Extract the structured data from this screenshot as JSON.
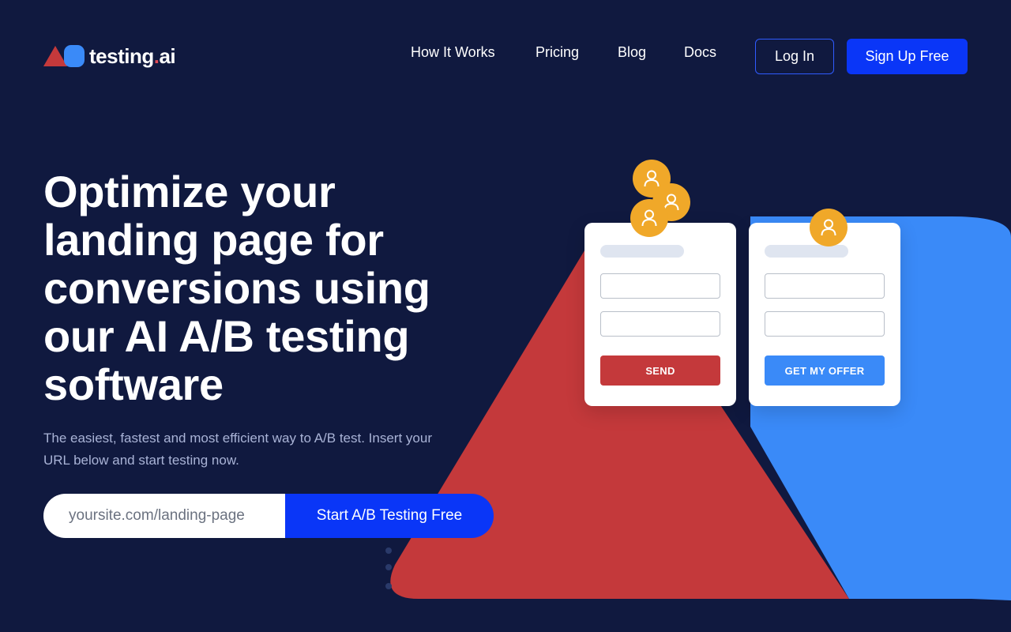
{
  "brand": {
    "name": "testing",
    "tld": "ai",
    "dot": ".",
    "colors": {
      "red": "#c4393b",
      "blue": "#3a8af8"
    }
  },
  "nav": {
    "items": [
      "How It Works",
      "Pricing",
      "Blog",
      "Docs"
    ]
  },
  "header": {
    "login_label": "Log In",
    "signup_label": "Sign Up Free"
  },
  "hero": {
    "title": "Optimize your landing page for conversions using our AI A/B testing software",
    "subtitle": "The easiest, fastest and most efficient way to A/B test. Insert your URL below and start testing now.",
    "url_placeholder": "yoursite.com/landing-page",
    "cta_label": "Start A/B Testing Free"
  },
  "illustration": {
    "variant_a_button": "SEND",
    "variant_b_button": "GET MY OFFER",
    "avatar_icon": "user-icon"
  },
  "colors": {
    "background": "#10193f",
    "accent": "#0a36f7",
    "avatar": "#f0a829"
  }
}
